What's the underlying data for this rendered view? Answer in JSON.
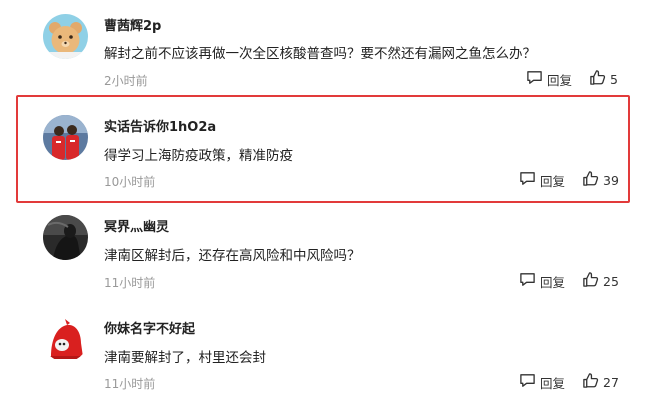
{
  "comments": [
    {
      "username": "曹茜辉2p",
      "content": "解封之前不应该再做一次全区核酸普查吗？要不然还有漏网之鱼怎么办？",
      "time": "2小时前",
      "reply_label": "回复",
      "likes": "5"
    },
    {
      "username": "实话告诉你1hO2a",
      "content": "得学习上海防疫政策，精准防疫",
      "time": "10小时前",
      "reply_label": "回复",
      "likes": "39"
    },
    {
      "username": "冥界灬幽灵",
      "content": "津南区解封后，还存在高风险和中风险吗？",
      "time": "11小时前",
      "reply_label": "回复",
      "likes": "25"
    },
    {
      "username": "你妹名字不好起",
      "content": "津南要解封了，村里还会封",
      "time": "11小时前",
      "reply_label": "回复",
      "likes": "27"
    }
  ],
  "colors": {
    "highlight_border": "#e23a3a",
    "time_text": "#999999",
    "text": "#222222"
  },
  "icons": {
    "reply": "comment-bubble-icon",
    "like": "thumbs-up-icon"
  }
}
